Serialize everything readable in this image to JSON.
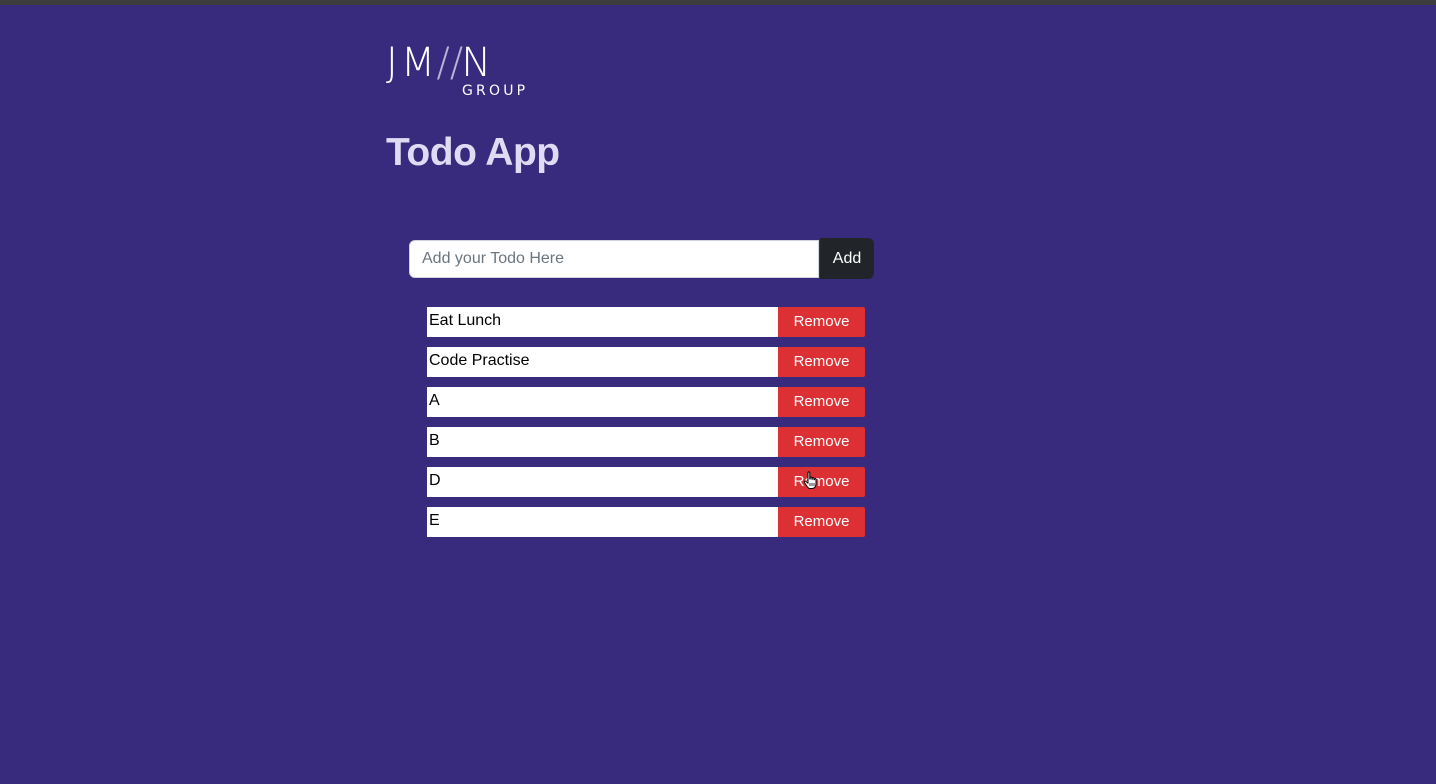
{
  "brand": {
    "logo_main_left": "JM",
    "logo_slash": "//",
    "logo_main_right": "N",
    "logo_sub": "GROUP"
  },
  "app": {
    "title": "Todo App"
  },
  "add_form": {
    "input_value": "",
    "placeholder": "Add your Todo Here",
    "button_label": "Add"
  },
  "todos": [
    {
      "text": "Eat Lunch",
      "remove_label": "Remove"
    },
    {
      "text": "Code Practise",
      "remove_label": "Remove"
    },
    {
      "text": "A",
      "remove_label": "Remove"
    },
    {
      "text": "B",
      "remove_label": "Remove"
    },
    {
      "text": "D",
      "remove_label": "Remove"
    },
    {
      "text": "E",
      "remove_label": "Remove"
    }
  ],
  "colors": {
    "background": "#382a7c",
    "title": "#dfdbf2",
    "add_button": "#212529",
    "remove_button": "#dc3035"
  },
  "cursor": {
    "icon": "hand-pointer-icon"
  }
}
